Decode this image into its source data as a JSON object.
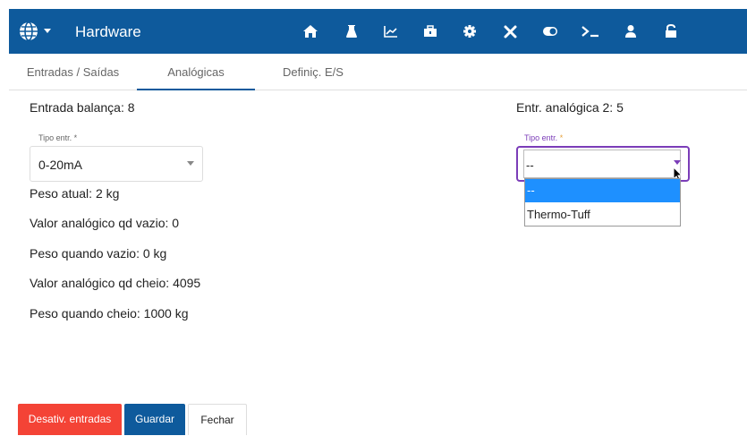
{
  "header": {
    "title": "Hardware",
    "bg_color": "#0e5a9c",
    "icons": [
      "globe-icon",
      "chevron-down-icon",
      "home-icon",
      "flask-icon",
      "chart-icon",
      "toolbox-icon",
      "gear-icon",
      "tools-icon",
      "toggle-icon",
      "terminal-icon",
      "user-icon",
      "lock-icon"
    ]
  },
  "tabs": [
    {
      "label": "Entradas / Saídas"
    },
    {
      "label": "Analógicas",
      "active": true
    },
    {
      "label": "Definiç. E/S"
    }
  ],
  "left": {
    "heading": "Entrada balança: 8",
    "select": {
      "legend": "Tipo entr. *",
      "value": "0-20mA"
    },
    "lines": [
      "Peso atual: 2 kg",
      "Valor analógico qd vazio: 0",
      "Peso quando vazio: 0 kg",
      "Valor analógico qd cheio: 4095",
      "Peso quando cheio: 1000 kg"
    ]
  },
  "right": {
    "heading": "Entr. analógica 2: 5",
    "select": {
      "legend": "Tipo entr.",
      "required_mark": "*",
      "value": "--",
      "options": [
        "--",
        "Thermo-Tuff"
      ],
      "selected_index": 0
    }
  },
  "buttons": {
    "disable": "Desativ. entradas",
    "save": "Guardar",
    "close": "Fechar"
  },
  "colors": {
    "accent": "#0e5a9c",
    "danger": "#f44336",
    "focus": "#7b3db8",
    "highlight": "#1e90ff"
  }
}
